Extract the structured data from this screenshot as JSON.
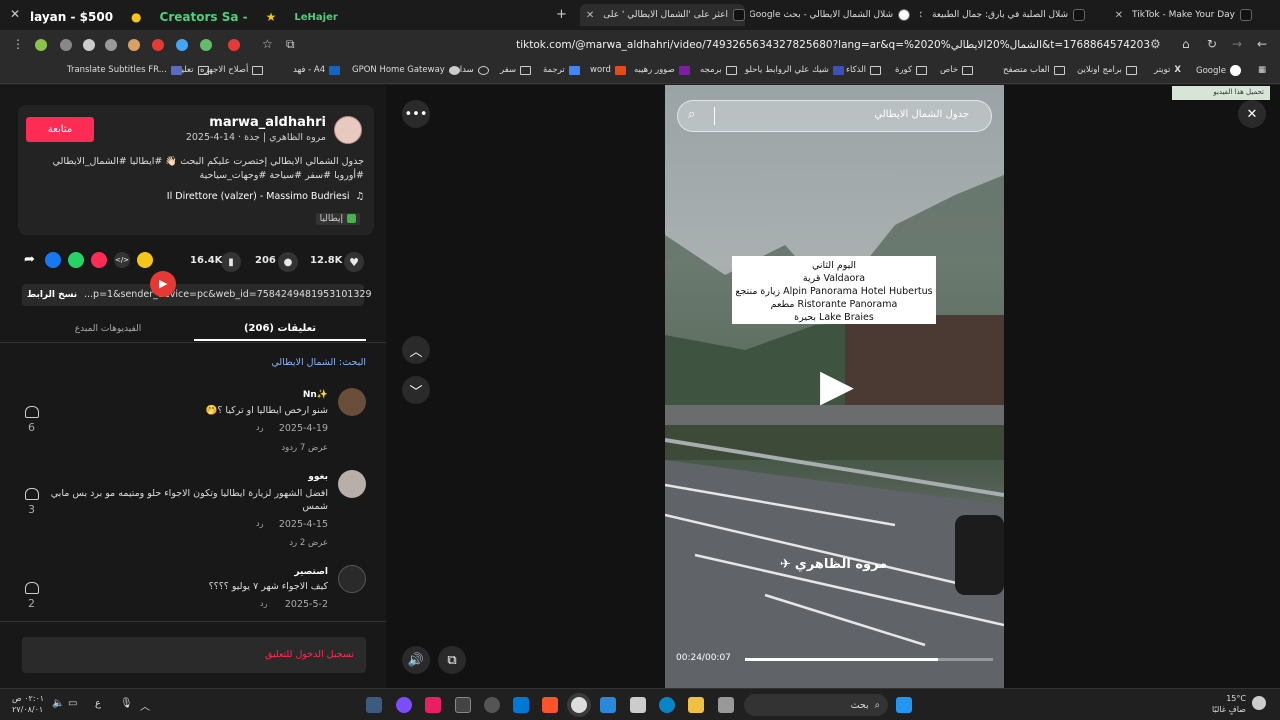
{
  "browser": {
    "tabs": [
      {
        "title": "TikTok - Make Your Day"
      },
      {
        "title": "شلال الصلبة في بارق: جمال الطبيعة"
      },
      {
        "title": "شلال الشمال الايطالي - بحث Google"
      },
      {
        "title": "اعثر على 'الشمال الايطالي ' على"
      }
    ],
    "overlay_banner": {
      "left": "layan - $500",
      "middle": "Creators Sa -",
      "right": "LeHajer"
    },
    "url": "tiktok.com/@marwa_aldhahri/video/7493265634327825680?lang=ar&q=%20الشمال%20الايطالي%20&t=1768864574203",
    "bookmarks": [
      {
        "label": "Google"
      },
      {
        "label": "تويتر"
      },
      {
        "label": "برامج اونلاين"
      },
      {
        "label": "العاب متصفح"
      },
      {
        "label": "خاص"
      },
      {
        "label": "كورة"
      },
      {
        "label": "الذكاء"
      },
      {
        "label": "شيك علي الروابط ياحلو"
      },
      {
        "label": "برمجه"
      },
      {
        "label": "صوور رهيبه"
      },
      {
        "label": "word"
      },
      {
        "label": "ترجمة"
      },
      {
        "label": "سفر"
      },
      {
        "label": "سداد"
      },
      {
        "label": "GPON Home Gateway"
      },
      {
        "label": "A4 - فهد"
      },
      {
        "label": "أصلاح الاجهزه"
      },
      {
        "label": "تعليم"
      },
      {
        "label": "Translate Subtitles FR..."
      }
    ],
    "translate_badge": "تحميل هذا الفيديو"
  },
  "post": {
    "username": "marwa_aldhahri",
    "subtitle": "مروه الظاهري | جدة · 14-4-2025",
    "follow_label": "متابعة",
    "caption": "جدول الشمالي الايطالي إختصرت عليكم البحث 👋🏻 #ايطاليا #الشمال_الايطالي #أوروبا #سفر #سياحة #وجهات_سياحية",
    "music": "Il Direttore (valzer) - Massimo Budriesi",
    "location_tag": "إيطاليا",
    "likes": "12.8K",
    "comments": "206",
    "saves": "16.4K",
    "link_value": "...p=1&sender_device=pc&web_id=7584249481953101329",
    "copy_link_label": "نسخ الرابط"
  },
  "tabs": {
    "comments_label": "تعليقات (206)",
    "creator_videos_label": "الفيديوهات المبدع"
  },
  "search_hint": "البحث: الشمال الايطالي",
  "comments": [
    {
      "name": "Nn✨",
      "text": "شنو ارخص ايطاليا او تركيا ؟🤭",
      "date": "2025-4-19",
      "reply": "رد",
      "likes": "6",
      "view_replies": "عرض 7 ردود"
    },
    {
      "name": "بغوو",
      "text": "افضل الشهور لزيارة ايطاليا وتكون الاجواء حلو ومتيمه مو برد بس مابي شمس",
      "date": "2025-4-15",
      "reply": "رد",
      "likes": "3",
      "view_replies": "عرض 2 رد"
    },
    {
      "name": "اصتصير",
      "text": "كيف الاجواء شهر ٧ يوليو ؟؟؟؟",
      "date": "2025-5-2",
      "reply": "رد",
      "likes": "2",
      "view_replies": ""
    }
  ],
  "login_prompt": "تسجيل الدخول للتعليق",
  "video": {
    "search_placeholder": "جدول الشمال الايطالي",
    "overlay_lines": [
      "اليوم الثاني",
      "قرية Valdaora",
      "زيارة منتجع Alpin Panorama Hotel Hubertus",
      "مطعم Ristorante Panorama",
      "بحيرة Lake Braies"
    ],
    "watermark": "مروه الظاهري",
    "time": "00:24/00:07",
    "progress": 0.78
  },
  "taskbar": {
    "weather_temp": "15°C",
    "weather_desc": "صافٍ غالبًا",
    "search_label": "بحث",
    "time": "٠٢:٠١ ص",
    "date": "٢٧/٠٨/٠١",
    "lang": "ع"
  }
}
